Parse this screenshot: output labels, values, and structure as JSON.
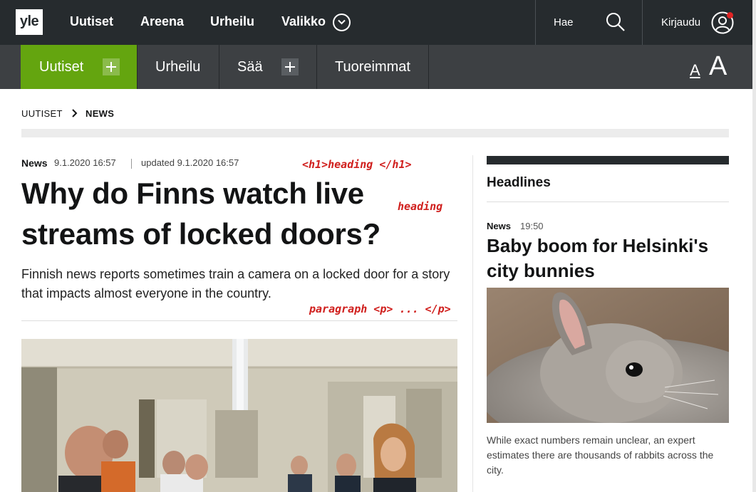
{
  "brand": {
    "logo_text": "yle",
    "accent_color": "#64a50f",
    "dark_color": "#262b2e",
    "annotation_color": "#d0201e"
  },
  "topnav": {
    "items": [
      "Uutiset",
      "Areena",
      "Urheilu",
      "Valikko"
    ],
    "search_label": "Hae",
    "login_label": "Kirjaudu"
  },
  "sections": {
    "items": [
      "Uutiset",
      "Urheilu",
      "Sää",
      "Tuoreimmat"
    ],
    "active": "Uutiset",
    "font_small": "A",
    "font_large": "A"
  },
  "breadcrumb": {
    "parent": "UUTISET",
    "current": "NEWS"
  },
  "article": {
    "category": "News",
    "published": "9.1.2020 16:57",
    "updated": "updated 9.1.2020 16:57",
    "headline_line1": "Why do Finns watch live",
    "headline_line2": "streams of locked doors?",
    "lead": "Finnish news reports sometimes train a camera on a locked door for a story that impacts almost everyone in the country."
  },
  "annotations": {
    "h1": "<h1>heading </h1>",
    "heading": "heading",
    "paragraph": "paragraph <p> ... </p>"
  },
  "sidebar": {
    "title": "Headlines",
    "item": {
      "category": "News",
      "time": "19:50",
      "headline": "Baby boom for Helsinki's city bunnies",
      "caption": "While exact numbers remain unclear, an expert estimates there are thousands of rabbits across the city."
    }
  }
}
